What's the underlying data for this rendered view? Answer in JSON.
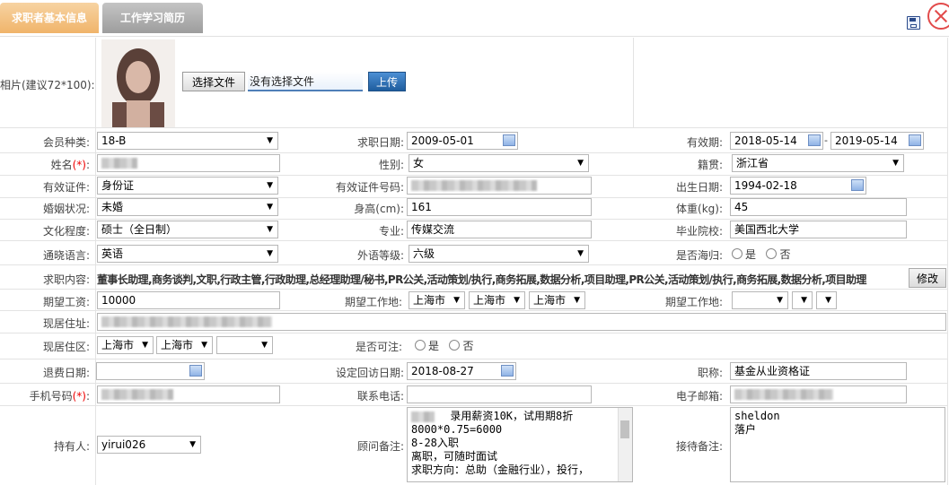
{
  "tabs": [
    {
      "label": "求职者基本信息"
    },
    {
      "label": "工作学习简历"
    }
  ],
  "photo_row": {
    "label": "相片(建议72*100):",
    "choose_button": "选择文件",
    "no_file_text": "没有选择文件",
    "upload_button": "上传"
  },
  "fields": {
    "member_type": {
      "label": "会员种类:",
      "value": "18-B"
    },
    "job_date": {
      "label": "求职日期:",
      "value": "2009-05-01"
    },
    "valid_period": {
      "label": "有效期:",
      "start": "2018-05-14",
      "sep": "-",
      "end": "2019-05-14"
    },
    "name": {
      "label": "姓名",
      "req": "(*)",
      "colon": ":"
    },
    "gender": {
      "label": "性别:",
      "value": "女"
    },
    "origin": {
      "label": "籍贯:",
      "value": "浙江省"
    },
    "id_type": {
      "label": "有效证件:",
      "value": "身份证"
    },
    "id_number": {
      "label": "有效证件号码:"
    },
    "birth_date": {
      "label": "出生日期:",
      "value": "1994-02-18"
    },
    "marital": {
      "label": "婚姻状况:",
      "value": "未婚"
    },
    "height": {
      "label": "身高(cm):",
      "value": "161"
    },
    "weight": {
      "label": "体重(kg):",
      "value": "45"
    },
    "education": {
      "label": "文化程度:",
      "value": "硕士（全日制）"
    },
    "major": {
      "label": "专业:",
      "value": "传媒交流"
    },
    "school": {
      "label": "毕业院校:",
      "value": "美国西北大学"
    },
    "language": {
      "label": "通晓语言:",
      "value": "英语"
    },
    "language_level": {
      "label": "外语等级:",
      "value": "六级"
    },
    "overseas": {
      "label": "是否海归:",
      "yes": "是",
      "no": "否"
    },
    "job_content": {
      "label": "求职内容:",
      "value": "董事长助理,商务谈判,文职,行政主管,行政助理,总经理助理/秘书,PR公关,活动策划/执行,商务拓展,数据分析,项目助理,PR公关,活动策划/执行,商务拓展,数据分析,项目助理",
      "edit_button": "修改"
    },
    "salary": {
      "label": "期望工资:",
      "value": "10000"
    },
    "work_location": {
      "label": "期望工作地:",
      "v1": "上海市",
      "v2": "上海市",
      "v3": "上海市"
    },
    "work_location2": {
      "label": "期望工作地:"
    },
    "address": {
      "label": "现居住址:"
    },
    "district": {
      "label": "现居住区:",
      "v1": "上海市",
      "v2": "上海市"
    },
    "visa": {
      "label": "是否可注:",
      "yes": "是",
      "no": "否"
    },
    "refund_date": {
      "label": "退费日期:"
    },
    "revisit_date": {
      "label": "设定回访日期:",
      "value": "2018-08-27"
    },
    "title": {
      "label": "职称:",
      "value": "基金从业资格证"
    },
    "mobile": {
      "label": "手机号码",
      "req": "(*)",
      "colon": ":"
    },
    "phone": {
      "label": "联系电话:"
    },
    "email": {
      "label": "电子邮箱:"
    },
    "holder": {
      "label": "持有人:",
      "value": "yirui026"
    },
    "advisor_note": {
      "label": "顾问备注:",
      "text": "      录用薪资10K，试用期8折\n8000*0.75=6000\n8-28入职\n离职，可随时面试\n求职方向：总助（金融行业），投行，"
    },
    "reception_note": {
      "label": "接待备注:",
      "text": "sheldon\n落户"
    }
  },
  "colors": {
    "tab_active": "#f0b46a",
    "tab_inactive": "#9d9d9d",
    "upload_button": "#2b73b8",
    "close": "#e24b4b"
  }
}
